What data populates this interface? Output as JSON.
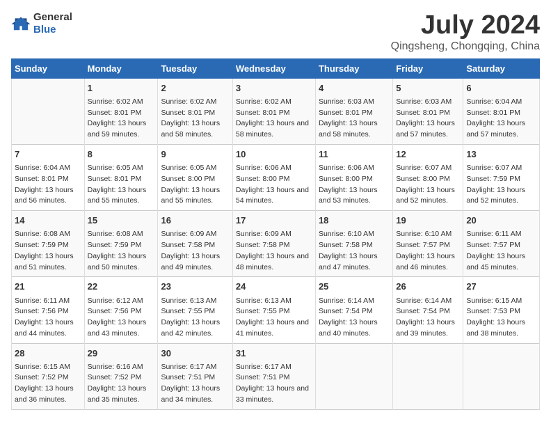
{
  "logo": {
    "general": "General",
    "blue": "Blue"
  },
  "title": "July 2024",
  "subtitle": "Qingsheng, Chongqing, China",
  "headers": [
    "Sunday",
    "Monday",
    "Tuesday",
    "Wednesday",
    "Thursday",
    "Friday",
    "Saturday"
  ],
  "weeks": [
    [
      {
        "day": "",
        "sunrise": "",
        "sunset": "",
        "daylight": ""
      },
      {
        "day": "1",
        "sunrise": "Sunrise: 6:02 AM",
        "sunset": "Sunset: 8:01 PM",
        "daylight": "Daylight: 13 hours and 59 minutes."
      },
      {
        "day": "2",
        "sunrise": "Sunrise: 6:02 AM",
        "sunset": "Sunset: 8:01 PM",
        "daylight": "Daylight: 13 hours and 58 minutes."
      },
      {
        "day": "3",
        "sunrise": "Sunrise: 6:02 AM",
        "sunset": "Sunset: 8:01 PM",
        "daylight": "Daylight: 13 hours and 58 minutes."
      },
      {
        "day": "4",
        "sunrise": "Sunrise: 6:03 AM",
        "sunset": "Sunset: 8:01 PM",
        "daylight": "Daylight: 13 hours and 58 minutes."
      },
      {
        "day": "5",
        "sunrise": "Sunrise: 6:03 AM",
        "sunset": "Sunset: 8:01 PM",
        "daylight": "Daylight: 13 hours and 57 minutes."
      },
      {
        "day": "6",
        "sunrise": "Sunrise: 6:04 AM",
        "sunset": "Sunset: 8:01 PM",
        "daylight": "Daylight: 13 hours and 57 minutes."
      }
    ],
    [
      {
        "day": "7",
        "sunrise": "Sunrise: 6:04 AM",
        "sunset": "Sunset: 8:01 PM",
        "daylight": "Daylight: 13 hours and 56 minutes."
      },
      {
        "day": "8",
        "sunrise": "Sunrise: 6:05 AM",
        "sunset": "Sunset: 8:01 PM",
        "daylight": "Daylight: 13 hours and 55 minutes."
      },
      {
        "day": "9",
        "sunrise": "Sunrise: 6:05 AM",
        "sunset": "Sunset: 8:00 PM",
        "daylight": "Daylight: 13 hours and 55 minutes."
      },
      {
        "day": "10",
        "sunrise": "Sunrise: 6:06 AM",
        "sunset": "Sunset: 8:00 PM",
        "daylight": "Daylight: 13 hours and 54 minutes."
      },
      {
        "day": "11",
        "sunrise": "Sunrise: 6:06 AM",
        "sunset": "Sunset: 8:00 PM",
        "daylight": "Daylight: 13 hours and 53 minutes."
      },
      {
        "day": "12",
        "sunrise": "Sunrise: 6:07 AM",
        "sunset": "Sunset: 8:00 PM",
        "daylight": "Daylight: 13 hours and 52 minutes."
      },
      {
        "day": "13",
        "sunrise": "Sunrise: 6:07 AM",
        "sunset": "Sunset: 7:59 PM",
        "daylight": "Daylight: 13 hours and 52 minutes."
      }
    ],
    [
      {
        "day": "14",
        "sunrise": "Sunrise: 6:08 AM",
        "sunset": "Sunset: 7:59 PM",
        "daylight": "Daylight: 13 hours and 51 minutes."
      },
      {
        "day": "15",
        "sunrise": "Sunrise: 6:08 AM",
        "sunset": "Sunset: 7:59 PM",
        "daylight": "Daylight: 13 hours and 50 minutes."
      },
      {
        "day": "16",
        "sunrise": "Sunrise: 6:09 AM",
        "sunset": "Sunset: 7:58 PM",
        "daylight": "Daylight: 13 hours and 49 minutes."
      },
      {
        "day": "17",
        "sunrise": "Sunrise: 6:09 AM",
        "sunset": "Sunset: 7:58 PM",
        "daylight": "Daylight: 13 hours and 48 minutes."
      },
      {
        "day": "18",
        "sunrise": "Sunrise: 6:10 AM",
        "sunset": "Sunset: 7:58 PM",
        "daylight": "Daylight: 13 hours and 47 minutes."
      },
      {
        "day": "19",
        "sunrise": "Sunrise: 6:10 AM",
        "sunset": "Sunset: 7:57 PM",
        "daylight": "Daylight: 13 hours and 46 minutes."
      },
      {
        "day": "20",
        "sunrise": "Sunrise: 6:11 AM",
        "sunset": "Sunset: 7:57 PM",
        "daylight": "Daylight: 13 hours and 45 minutes."
      }
    ],
    [
      {
        "day": "21",
        "sunrise": "Sunrise: 6:11 AM",
        "sunset": "Sunset: 7:56 PM",
        "daylight": "Daylight: 13 hours and 44 minutes."
      },
      {
        "day": "22",
        "sunrise": "Sunrise: 6:12 AM",
        "sunset": "Sunset: 7:56 PM",
        "daylight": "Daylight: 13 hours and 43 minutes."
      },
      {
        "day": "23",
        "sunrise": "Sunrise: 6:13 AM",
        "sunset": "Sunset: 7:55 PM",
        "daylight": "Daylight: 13 hours and 42 minutes."
      },
      {
        "day": "24",
        "sunrise": "Sunrise: 6:13 AM",
        "sunset": "Sunset: 7:55 PM",
        "daylight": "Daylight: 13 hours and 41 minutes."
      },
      {
        "day": "25",
        "sunrise": "Sunrise: 6:14 AM",
        "sunset": "Sunset: 7:54 PM",
        "daylight": "Daylight: 13 hours and 40 minutes."
      },
      {
        "day": "26",
        "sunrise": "Sunrise: 6:14 AM",
        "sunset": "Sunset: 7:54 PM",
        "daylight": "Daylight: 13 hours and 39 minutes."
      },
      {
        "day": "27",
        "sunrise": "Sunrise: 6:15 AM",
        "sunset": "Sunset: 7:53 PM",
        "daylight": "Daylight: 13 hours and 38 minutes."
      }
    ],
    [
      {
        "day": "28",
        "sunrise": "Sunrise: 6:15 AM",
        "sunset": "Sunset: 7:52 PM",
        "daylight": "Daylight: 13 hours and 36 minutes."
      },
      {
        "day": "29",
        "sunrise": "Sunrise: 6:16 AM",
        "sunset": "Sunset: 7:52 PM",
        "daylight": "Daylight: 13 hours and 35 minutes."
      },
      {
        "day": "30",
        "sunrise": "Sunrise: 6:17 AM",
        "sunset": "Sunset: 7:51 PM",
        "daylight": "Daylight: 13 hours and 34 minutes."
      },
      {
        "day": "31",
        "sunrise": "Sunrise: 6:17 AM",
        "sunset": "Sunset: 7:51 PM",
        "daylight": "Daylight: 13 hours and 33 minutes."
      },
      {
        "day": "",
        "sunrise": "",
        "sunset": "",
        "daylight": ""
      },
      {
        "day": "",
        "sunrise": "",
        "sunset": "",
        "daylight": ""
      },
      {
        "day": "",
        "sunrise": "",
        "sunset": "",
        "daylight": ""
      }
    ]
  ]
}
